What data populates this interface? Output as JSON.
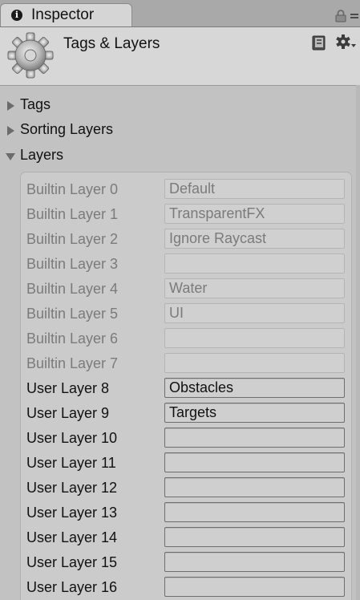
{
  "tab": {
    "label": "Inspector",
    "info_icon_glyph": "i"
  },
  "header": {
    "title": "Tags & Layers"
  },
  "foldouts": [
    {
      "label": "Tags",
      "expanded": false
    },
    {
      "label": "Sorting Layers",
      "expanded": false
    },
    {
      "label": "Layers",
      "expanded": true
    }
  ],
  "layers": [
    {
      "label": "Builtin Layer 0",
      "value": "Default",
      "editable": false
    },
    {
      "label": "Builtin Layer 1",
      "value": "TransparentFX",
      "editable": false
    },
    {
      "label": "Builtin Layer 2",
      "value": "Ignore Raycast",
      "editable": false
    },
    {
      "label": "Builtin Layer 3",
      "value": "",
      "editable": false
    },
    {
      "label": "Builtin Layer 4",
      "value": "Water",
      "editable": false
    },
    {
      "label": "Builtin Layer 5",
      "value": "UI",
      "editable": false
    },
    {
      "label": "Builtin Layer 6",
      "value": "",
      "editable": false
    },
    {
      "label": "Builtin Layer 7",
      "value": "",
      "editable": false
    },
    {
      "label": "User Layer 8",
      "value": "Obstacles",
      "editable": true
    },
    {
      "label": "User Layer 9",
      "value": "Targets",
      "editable": true
    },
    {
      "label": "User Layer 10",
      "value": "",
      "editable": true
    },
    {
      "label": "User Layer 11",
      "value": "",
      "editable": true
    },
    {
      "label": "User Layer 12",
      "value": "",
      "editable": true
    },
    {
      "label": "User Layer 13",
      "value": "",
      "editable": true
    },
    {
      "label": "User Layer 14",
      "value": "",
      "editable": true
    },
    {
      "label": "User Layer 15",
      "value": "",
      "editable": true
    },
    {
      "label": "User Layer 16",
      "value": "",
      "editable": true
    }
  ],
  "icons": {
    "tab": "info-icon",
    "lock": "lock-icon",
    "menu": "menu-dots-icon",
    "asset": "gear-icon",
    "help": "help-book-icon",
    "settings": "settings-gear-icon",
    "collapsed": "triangle-right-icon",
    "expanded": "triangle-down-icon"
  }
}
